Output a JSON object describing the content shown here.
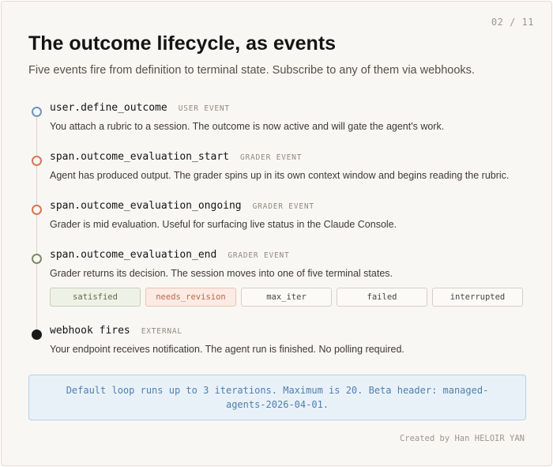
{
  "page_number": "02 / 11",
  "title": "The outcome lifecycle, as events",
  "subtitle": "Five events fire from definition to terminal state. Subscribe to any of them via webhooks.",
  "events": [
    {
      "name": "user.define_outcome",
      "tag": "USER EVENT",
      "description": "You attach a rubric to a session. The outcome is now active and will gate the agent's work.",
      "dot_color": "#6b96c4"
    },
    {
      "name": "span.outcome_evaluation_start",
      "tag": "GRADER EVENT",
      "description": "Agent has produced output. The grader spins up in its own context window and begins reading the rubric.",
      "dot_color": "#d2775a"
    },
    {
      "name": "span.outcome_evaluation_ongoing",
      "tag": "GRADER EVENT",
      "description": "Grader is mid evaluation. Useful for surfacing live status in the Claude Console.",
      "dot_color": "#d2775a"
    },
    {
      "name": "span.outcome_evaluation_end",
      "tag": "GRADER EVENT",
      "description": "Grader returns its decision. The session moves into one of five terminal states.",
      "dot_color": "#7d8c64"
    },
    {
      "name": "webhook fires",
      "tag": "EXTERNAL",
      "description": "Your endpoint receives notification. The agent run is finished. No polling required.",
      "dot_color": "#1a1a1a"
    }
  ],
  "terminal_states": [
    "satisfied",
    "needs_revision",
    "max_iter",
    "failed",
    "interrupted"
  ],
  "note": "Default loop runs up to 3 iterations. Maximum is 20. Beta header: managed-agents-2026-04-01.",
  "credit": "Created by Han HELOIR YAN"
}
